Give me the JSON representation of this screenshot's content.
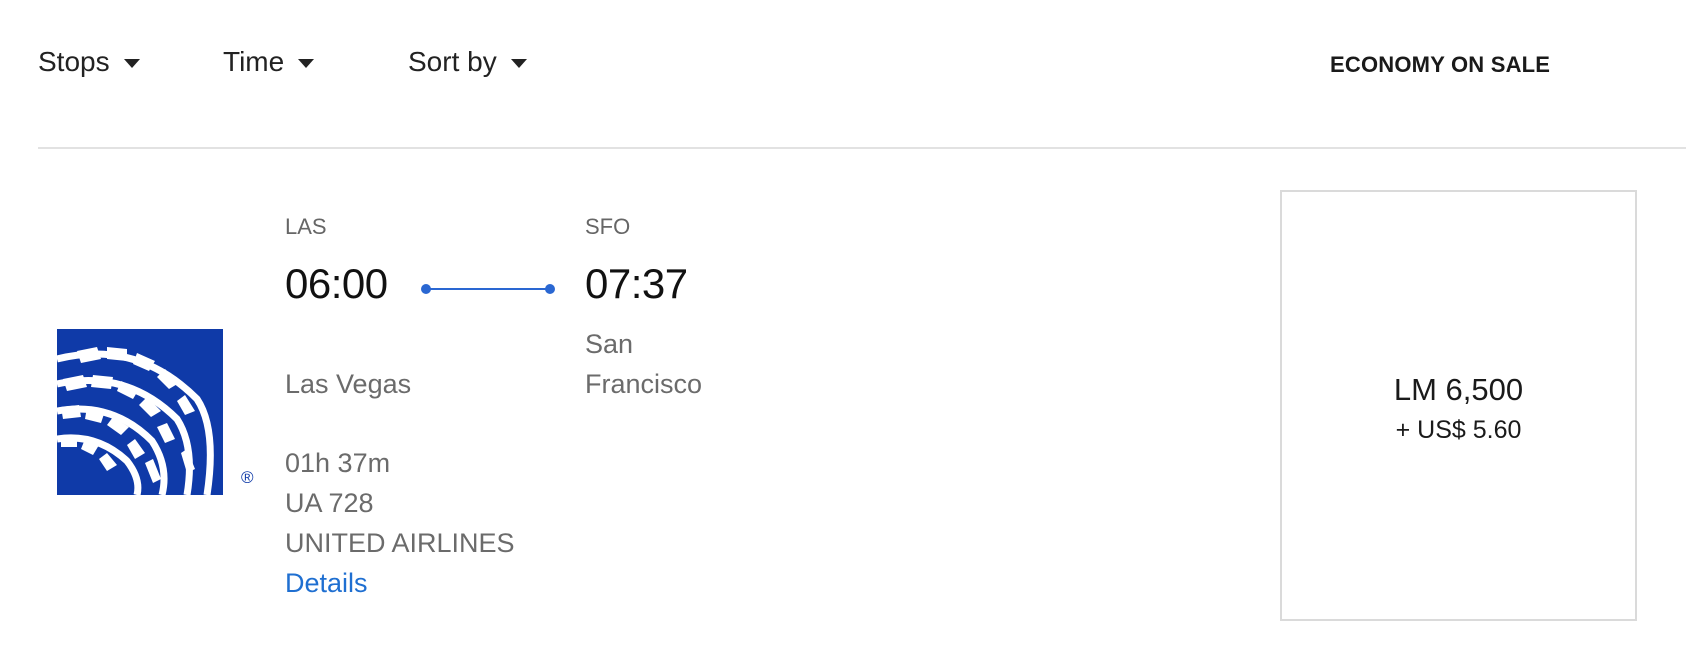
{
  "filters": {
    "stops_label": "Stops",
    "time_label": "Time",
    "sort_label": "Sort by"
  },
  "cabin_header": "ECONOMY ON SALE",
  "flight": {
    "origin_code": "LAS",
    "destination_code": "SFO",
    "departure_time": "06:00",
    "arrival_time": "07:37",
    "origin_city": "Las Vegas",
    "destination_city": "San Francisco",
    "duration": "01h 37m",
    "flight_number": "UA 728",
    "airline": "UNITED AIRLINES",
    "details_label": "Details",
    "logo_icon": "united-airlines-globe-logo",
    "registered_mark": "®"
  },
  "fare": {
    "miles": "LM 6,500",
    "cash": "+ US$ 5.60"
  },
  "colors": {
    "brand_blue": "#0f3aa8",
    "route_blue": "#2a67d2",
    "link_blue": "#1f6fd1",
    "divider": "#e2e2e2"
  }
}
